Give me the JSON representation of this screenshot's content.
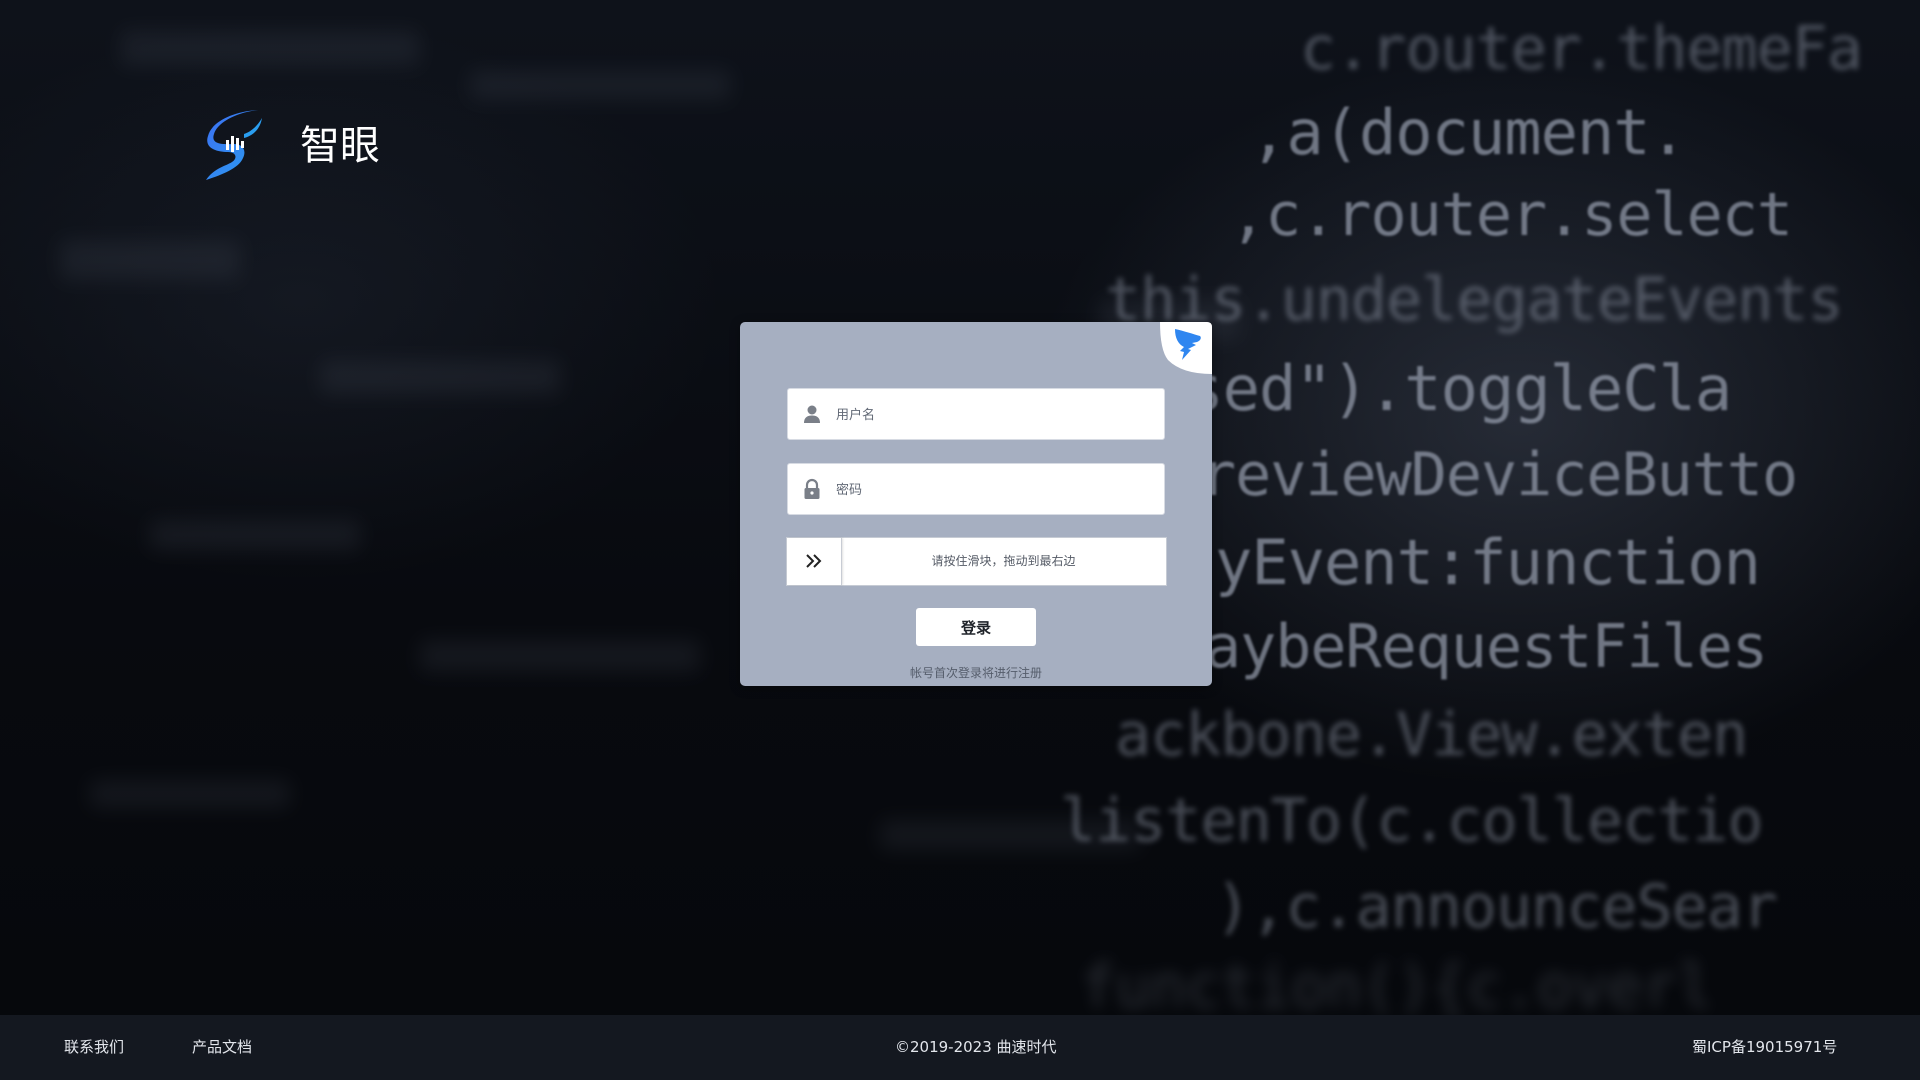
{
  "brand": {
    "name": "智眼"
  },
  "login": {
    "username_placeholder": "用户名",
    "password_placeholder": "密码",
    "slider_text": "请按住滑块，拖动到最右边",
    "submit_label": "登录",
    "hint": "帐号首次登录将进行注册"
  },
  "background_code": [
    "c.router.themeFa",
    ",a(document.",
    ",c.router.select",
    "this.undelegateEvents",
    "osed\").toggleCla",
    "reviewDeviceButto",
    "yEvent:function",
    "aybeRequestFiles",
    "ackbone.View.exten",
    "listenTo(c.collectio",
    "),c.announceSear",
    "function(){c.overl"
  ],
  "footer": {
    "contact": "联系我们",
    "docs": "产品文档",
    "copyright": "©2019-2023 曲速时代",
    "icp": "蜀ICP备19015971号"
  },
  "colors": {
    "card_background": "#a6afc1",
    "footer_background": "#141820",
    "logo_blue": "#2f86f0",
    "brand_text": "#ffffff"
  },
  "icons": {
    "logo": "s-shaped-logo-icon",
    "corner": "dingtalk-icon",
    "username": "user-icon",
    "password": "lock-icon",
    "slider": "double-chevron-right-icon"
  }
}
